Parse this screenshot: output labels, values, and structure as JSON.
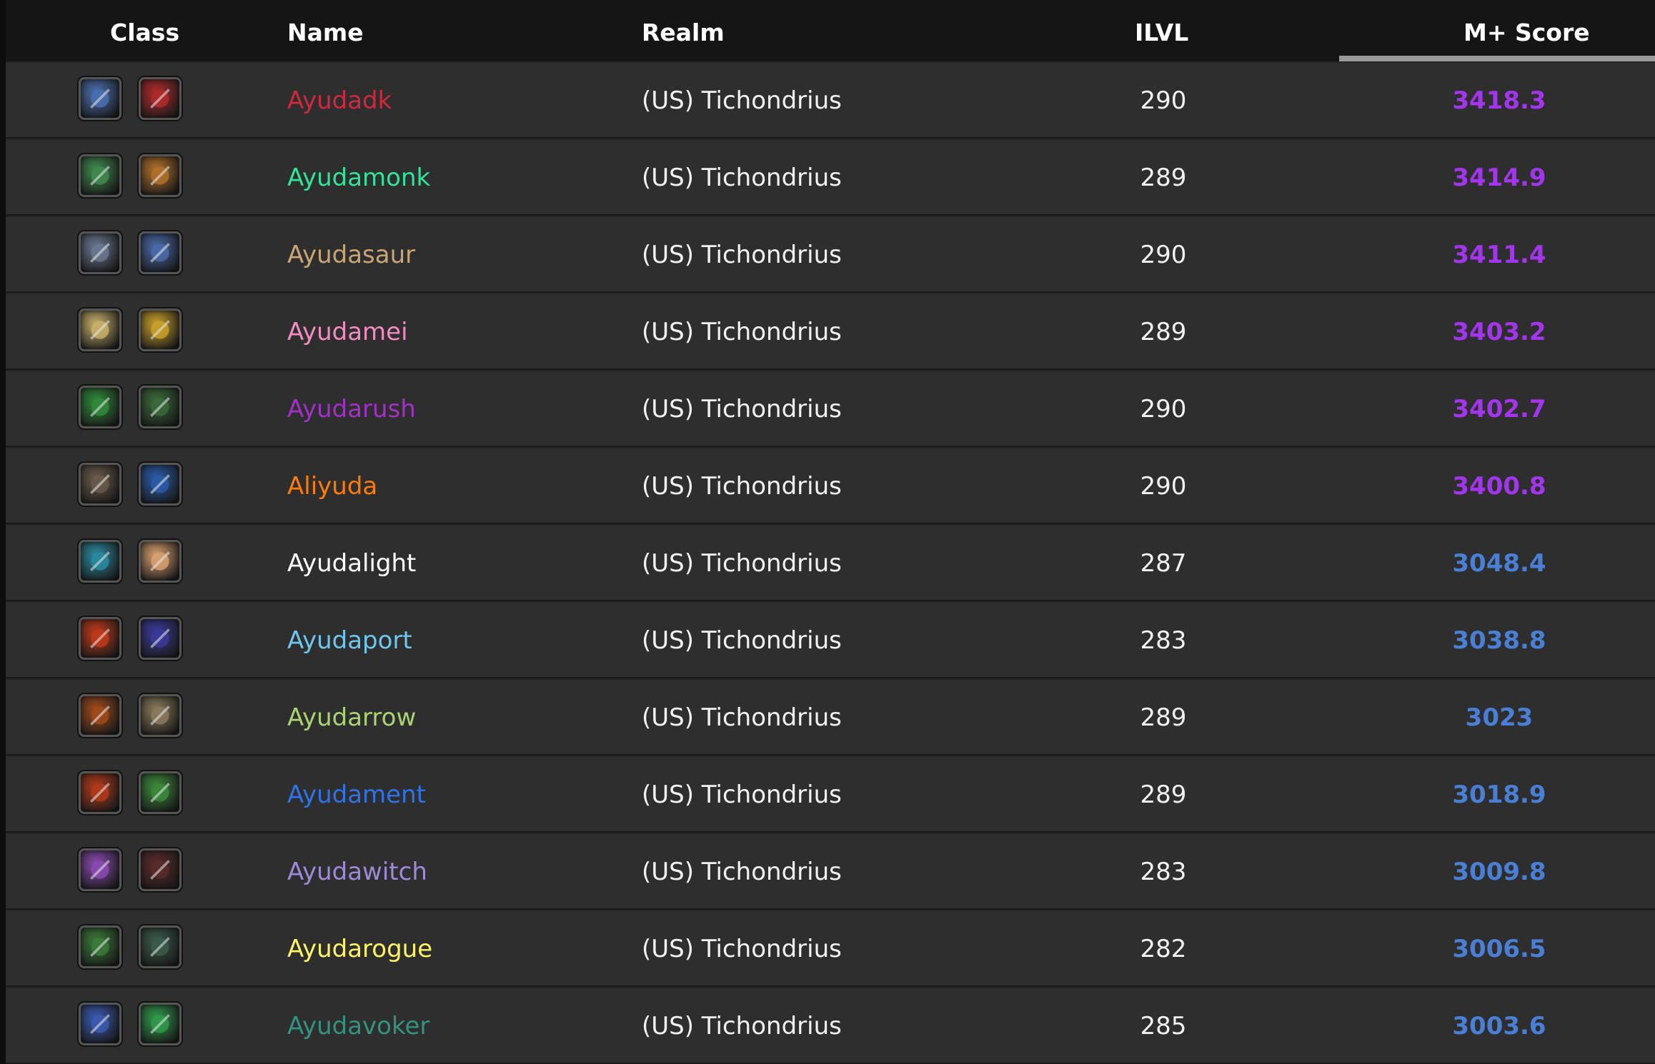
{
  "header": {
    "class": "Class",
    "name": "Name",
    "realm": "Realm",
    "ilvl": "ILVL",
    "score": "M+ Score"
  },
  "rows": [
    {
      "name": "Ayudadk",
      "name_color": "#d0283c",
      "realm": "(US) Tichondrius",
      "ilvl": "290",
      "score": "3418.3",
      "score_color": "#a335ee",
      "icons": [
        {
          "name": "frost-rune-sword-icon",
          "color": "#4a6fb0"
        },
        {
          "name": "blood-skull-icon",
          "color": "#b02a2a"
        }
      ]
    },
    {
      "name": "Ayudamonk",
      "name_color": "#33e39a",
      "realm": "(US) Tichondrius",
      "ilvl": "289",
      "score": "3414.9",
      "score_color": "#a335ee",
      "icons": [
        {
          "name": "jade-serpent-icon",
          "color": "#3f8a4e"
        },
        {
          "name": "brewmaster-ox-icon",
          "color": "#b0702a"
        }
      ]
    },
    {
      "name": "Ayudasaur",
      "name_color": "#c9a674",
      "realm": "(US) Tichondrius",
      "ilvl": "290",
      "score": "3411.4",
      "score_color": "#a335ee",
      "icons": [
        {
          "name": "sword-icon",
          "color": "#6a7890"
        },
        {
          "name": "shield-icon",
          "color": "#4a6aa8"
        }
      ]
    },
    {
      "name": "Ayudamei",
      "name_color": "#f28cc2",
      "realm": "(US) Tichondrius",
      "ilvl": "289",
      "score": "3403.2",
      "score_color": "#a335ee",
      "icons": [
        {
          "name": "holy-hammer-icon",
          "color": "#c7b06a"
        },
        {
          "name": "golden-helm-icon",
          "color": "#c9a02a"
        }
      ]
    },
    {
      "name": "Ayudarush",
      "name_color": "#a330c9",
      "realm": "(US) Tichondrius",
      "ilvl": "290",
      "score": "3402.7",
      "score_color": "#a335ee",
      "icons": [
        {
          "name": "fel-claw-icon",
          "color": "#2f8a3a"
        },
        {
          "name": "demon-horns-icon",
          "color": "#3a6a3a"
        }
      ]
    },
    {
      "name": "Aliyuda",
      "name_color": "#ff7c0a",
      "realm": "(US) Tichondrius",
      "ilvl": "290",
      "score": "3400.8",
      "score_color": "#a335ee",
      "icons": [
        {
          "name": "bear-claw-icon",
          "color": "#6a5a4a"
        },
        {
          "name": "blue-paw-icon",
          "color": "#2a5aa8"
        }
      ]
    },
    {
      "name": "Ayudalight",
      "name_color": "#ffffff",
      "realm": "(US) Tichondrius",
      "ilvl": "287",
      "score": "3048.4",
      "score_color": "#4a7fd6",
      "icons": [
        {
          "name": "holy-staff-icon",
          "color": "#2a8aa0"
        },
        {
          "name": "holy-shield-icon",
          "color": "#d8a070"
        }
      ]
    },
    {
      "name": "Ayudaport",
      "name_color": "#6ec7ee",
      "realm": "(US) Tichondrius",
      "ilvl": "283",
      "score": "3038.8",
      "score_color": "#4a7fd6",
      "icons": [
        {
          "name": "fire-wand-icon",
          "color": "#c03a1a"
        },
        {
          "name": "arcane-bolt-icon",
          "color": "#3a3a9a"
        }
      ]
    },
    {
      "name": "Ayudarrow",
      "name_color": "#aad372",
      "realm": "(US) Tichondrius",
      "ilvl": "289",
      "score": "3023",
      "score_color": "#4a7fd6",
      "icons": [
        {
          "name": "bow-icon",
          "color": "#a04a1a"
        },
        {
          "name": "armored-hunter-icon",
          "color": "#8a7a5a"
        }
      ]
    },
    {
      "name": "Ayudament",
      "name_color": "#2f73e8",
      "realm": "(US) Tichondrius",
      "ilvl": "289",
      "score": "3018.9",
      "score_color": "#4a7fd6",
      "icons": [
        {
          "name": "totem-mask-icon",
          "color": "#b03a1a"
        },
        {
          "name": "nature-hand-icon",
          "color": "#3a8a3a"
        }
      ]
    },
    {
      "name": "Ayudawitch",
      "name_color": "#9f8ad8",
      "realm": "(US) Tichondrius",
      "ilvl": "283",
      "score": "3009.8",
      "score_color": "#4a7fd6",
      "icons": [
        {
          "name": "shadow-hand-icon",
          "color": "#8a4ab0"
        },
        {
          "name": "demon-face-icon",
          "color": "#5a2a2a"
        }
      ]
    },
    {
      "name": "Ayudarogue",
      "name_color": "#fff468",
      "realm": "(US) Tichondrius",
      "ilvl": "282",
      "score": "3006.5",
      "score_color": "#4a7fd6",
      "icons": [
        {
          "name": "poison-dagger-icon",
          "color": "#3a7a3a"
        },
        {
          "name": "hooded-rogue-icon",
          "color": "#3a5a4a"
        }
      ]
    },
    {
      "name": "Ayudavoker",
      "name_color": "#33937f",
      "realm": "(US) Tichondrius",
      "ilvl": "285",
      "score": "3003.6",
      "score_color": "#4a7fd6",
      "icons": [
        {
          "name": "dragon-claw-icon",
          "color": "#3a5ab0"
        },
        {
          "name": "green-clover-icon",
          "color": "#2f9a4a"
        }
      ]
    }
  ]
}
